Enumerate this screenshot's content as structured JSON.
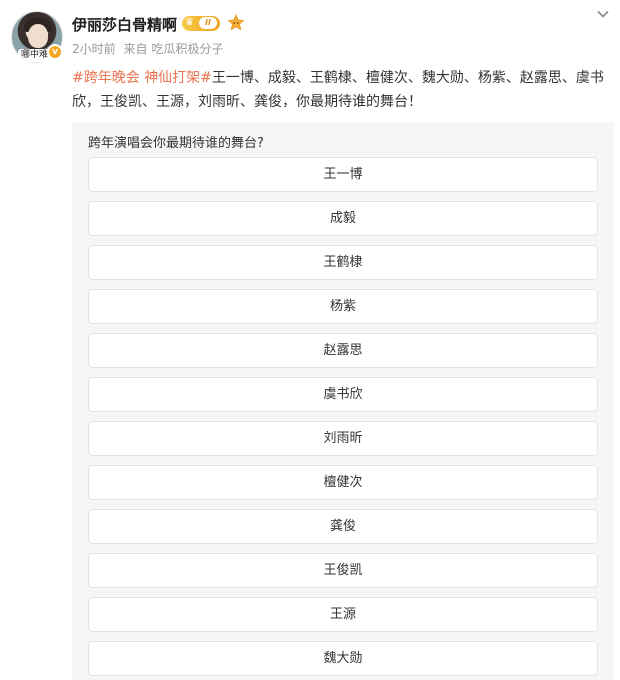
{
  "user": {
    "name": "伊丽莎白骨精啊",
    "avatar_tag": "哪中难",
    "level": "II",
    "verified_glyph": "v"
  },
  "meta": {
    "time": "2小时前",
    "source_prefix": "来自",
    "source": "吃瓜积极分子"
  },
  "post": {
    "hashtag1": "#跨年晚会",
    "hashtag2": "神仙打架#",
    "text": "王一博、成毅、王鹤棣、檀健次、魏大勋、杨紫、赵露思、虞书欣，王俊凯、王源，刘雨昕、龚俊，你最期待谁的舞台！"
  },
  "poll": {
    "question": "跨年演唱会你最期待谁的舞台?",
    "options": [
      "王一博",
      "成毅",
      "王鹤棣",
      "杨紫",
      "赵露思",
      "虞书欣",
      "刘雨昕",
      "檀健次",
      "龚俊",
      "王俊凯",
      "王源",
      "魏大勋"
    ]
  },
  "colors": {
    "hashtag": "#eb7350",
    "badge": "#f0a321"
  },
  "icons": [
    "crown-icon",
    "fan-icon",
    "chevron-down-icon",
    "verified-icon"
  ]
}
